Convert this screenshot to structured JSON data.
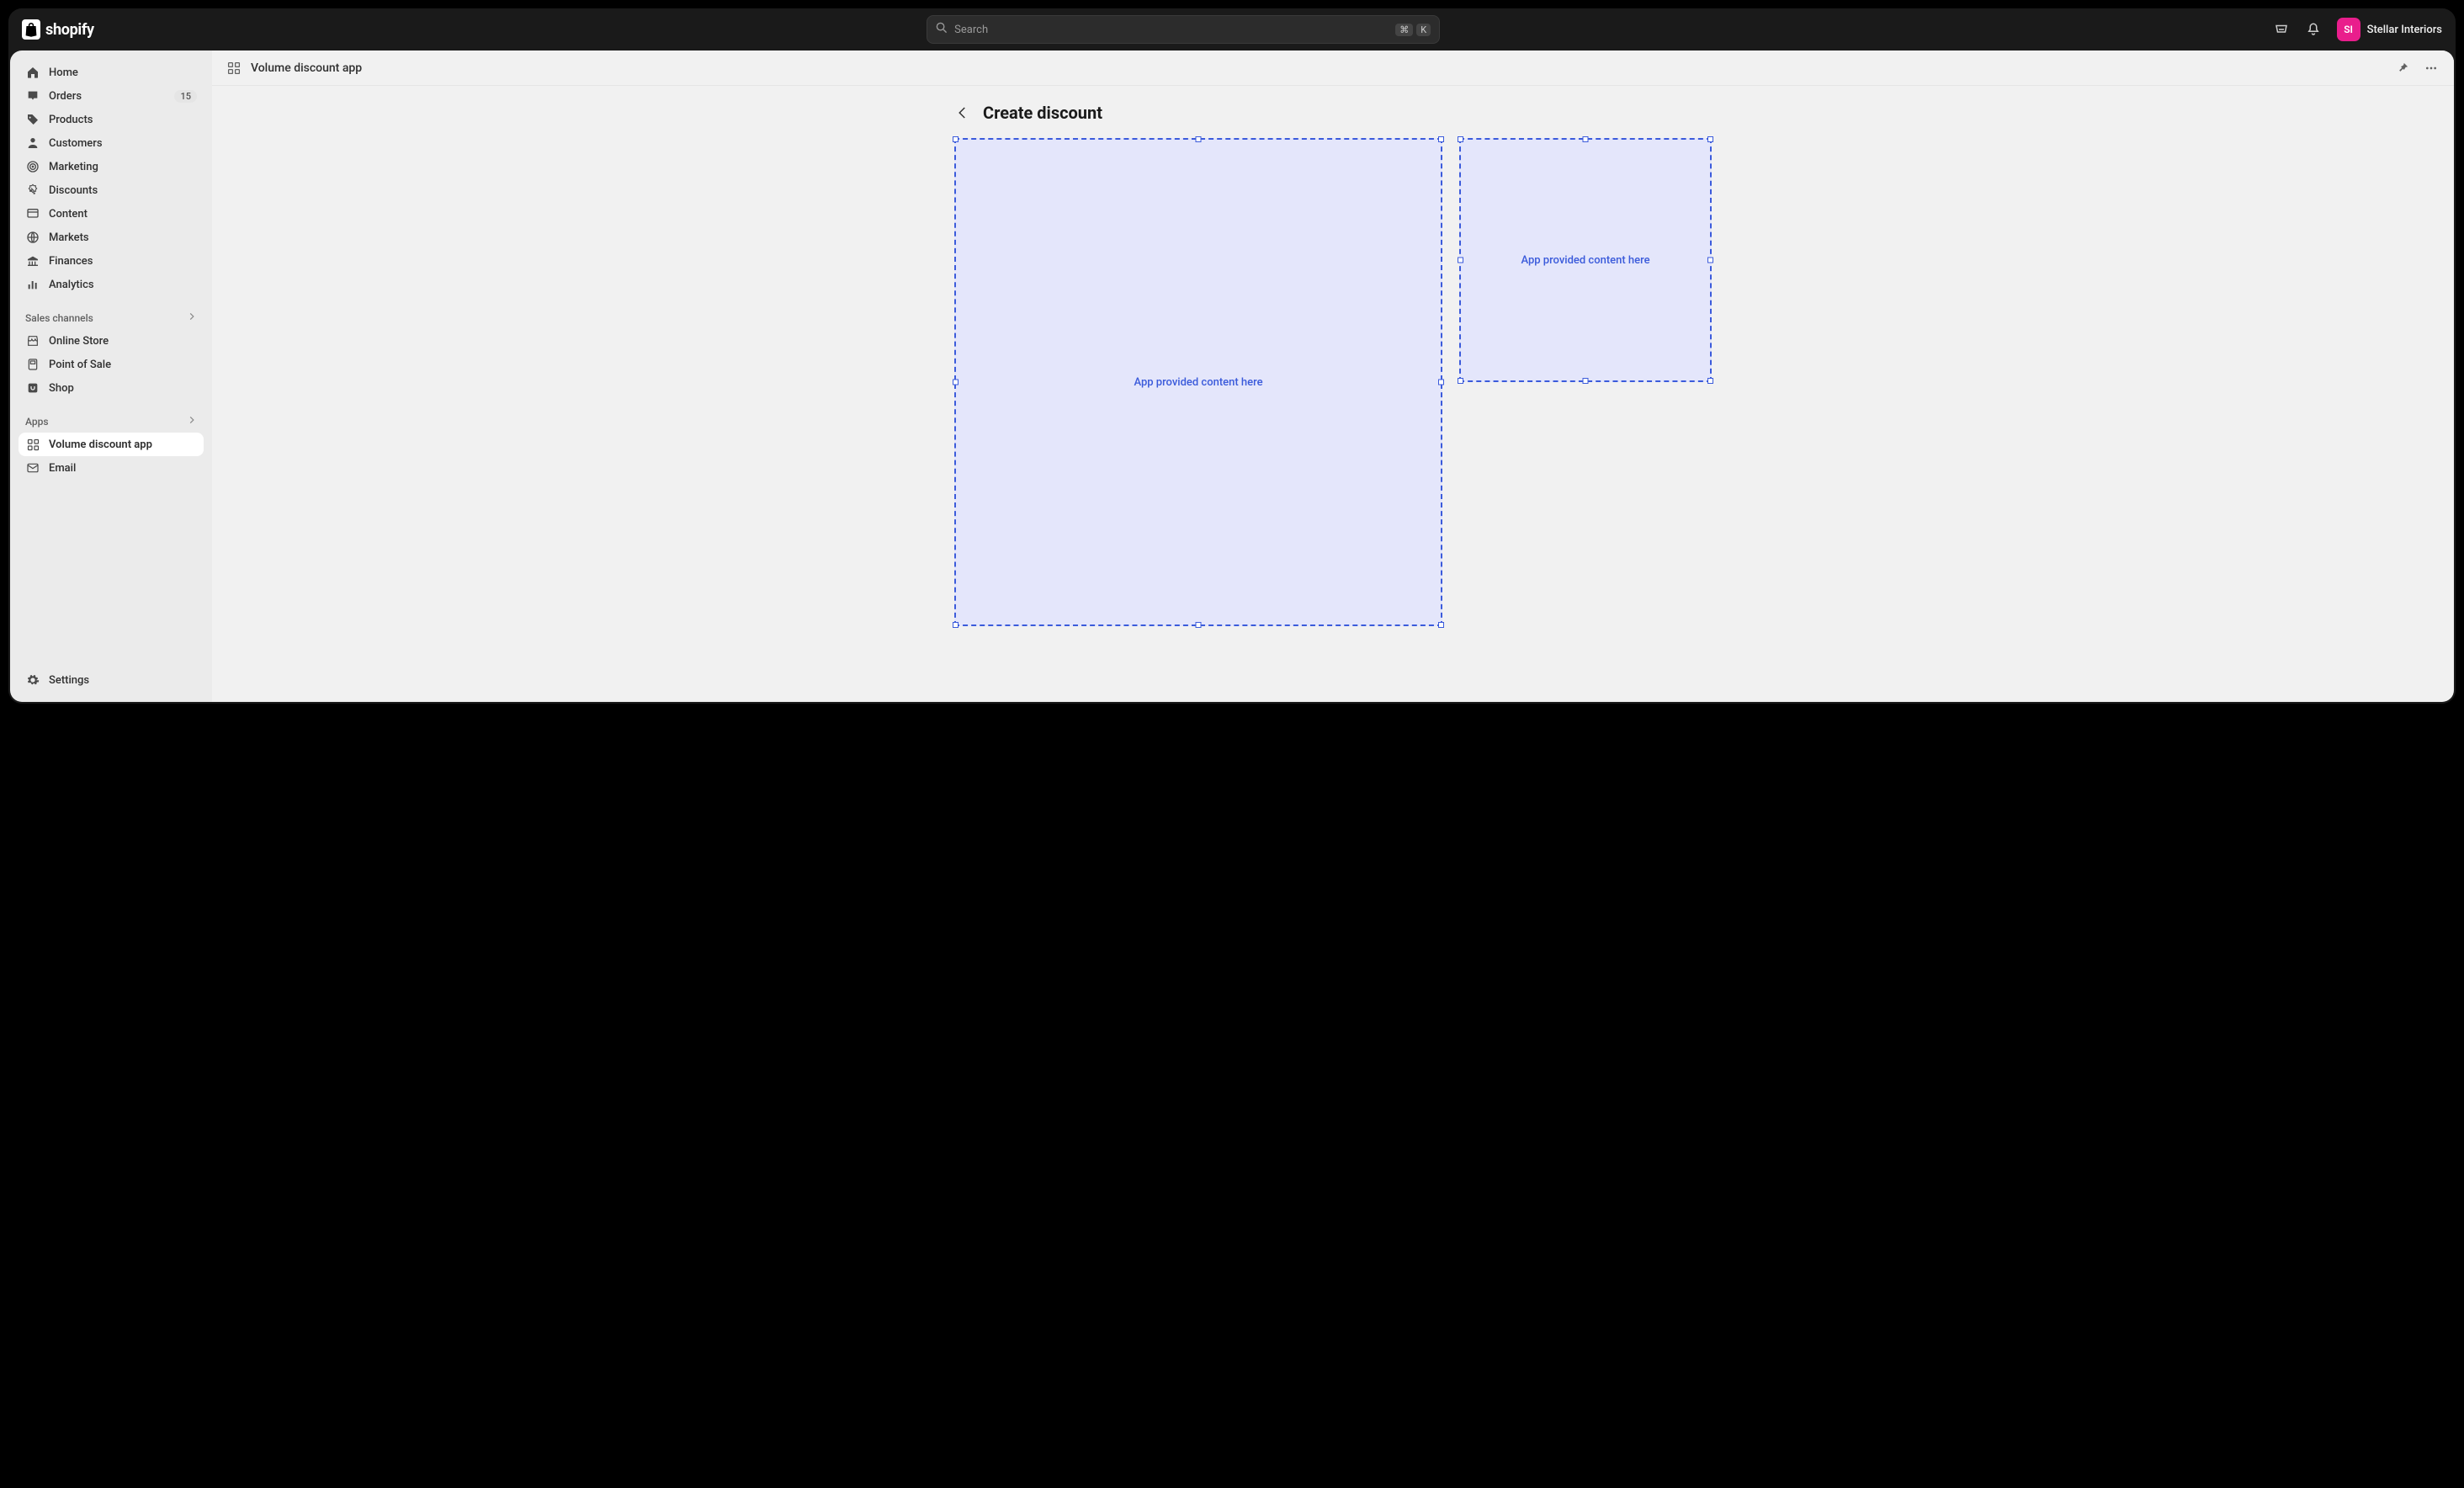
{
  "brand": {
    "name": "shopify",
    "logo_letter": "S"
  },
  "search": {
    "placeholder": "Search",
    "shortcut1": "⌘",
    "shortcut2": "K"
  },
  "store": {
    "initials": "SI",
    "name": "Stellar Interiors"
  },
  "sidebar": {
    "main_items": [
      {
        "id": "home",
        "label": "Home",
        "icon": "home",
        "badge": ""
      },
      {
        "id": "orders",
        "label": "Orders",
        "icon": "inbox",
        "badge": "15"
      },
      {
        "id": "products",
        "label": "Products",
        "icon": "tag",
        "badge": ""
      },
      {
        "id": "customers",
        "label": "Customers",
        "icon": "person",
        "badge": ""
      },
      {
        "id": "marketing",
        "label": "Marketing",
        "icon": "target",
        "badge": ""
      },
      {
        "id": "discounts",
        "label": "Discounts",
        "icon": "discount",
        "badge": ""
      },
      {
        "id": "content",
        "label": "Content",
        "icon": "content",
        "badge": ""
      },
      {
        "id": "markets",
        "label": "Markets",
        "icon": "globe",
        "badge": ""
      },
      {
        "id": "finances",
        "label": "Finances",
        "icon": "bank",
        "badge": ""
      },
      {
        "id": "analytics",
        "label": "Analytics",
        "icon": "bars",
        "badge": ""
      }
    ],
    "sales_header": "Sales channels",
    "sales_items": [
      {
        "id": "online-store",
        "label": "Online Store",
        "icon": "store"
      },
      {
        "id": "pos",
        "label": "Point of Sale",
        "icon": "pos"
      },
      {
        "id": "shop",
        "label": "Shop",
        "icon": "shop"
      }
    ],
    "apps_header": "Apps",
    "app_items": [
      {
        "id": "volume-discount",
        "label": "Volume discount app",
        "icon": "apps",
        "active": true
      },
      {
        "id": "email",
        "label": "Email",
        "icon": "mail",
        "active": false
      }
    ],
    "settings": {
      "label": "Settings",
      "icon": "gear"
    }
  },
  "app_header": {
    "title": "Volume discount app"
  },
  "page": {
    "title": "Create discount",
    "placeholder_left": "App provided content here",
    "placeholder_right": "App provided content here"
  }
}
